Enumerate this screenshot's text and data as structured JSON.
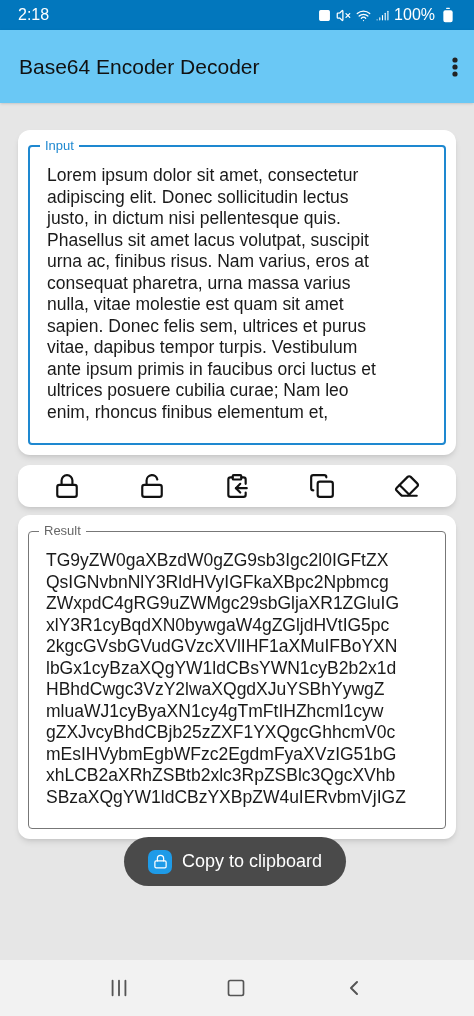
{
  "status_bar": {
    "time": "2:18",
    "battery": "100%"
  },
  "app_bar": {
    "title": "Base64 Encoder Decoder"
  },
  "input": {
    "label": "Input",
    "focused": true,
    "value_lines": [
      "Lorem ipsum dolor sit amet, consectetur",
      "adipiscing elit. Donec sollicitudin lectus",
      "justo, in dictum nisi pellentesque quis.",
      "Phasellus sit amet lacus volutpat, suscipit",
      "urna ac, finibus risus. Nam varius, eros at",
      "consequat pharetra, urna massa varius",
      "nulla, vitae molestie est quam sit amet",
      "sapien. Donec felis sem, ultrices et purus",
      "vitae, dapibus tempor turpis. Vestibulum",
      "ante ipsum primis in faucibus orci luctus et",
      "ultrices posuere cubilia curae; Nam leo",
      "enim, rhoncus finibus elementum et,"
    ]
  },
  "toolbar": [
    {
      "kind": "encode"
    },
    {
      "kind": "decode"
    },
    {
      "kind": "paste"
    },
    {
      "kind": "copy"
    },
    {
      "kind": "clear"
    }
  ],
  "result": {
    "label": "Result",
    "focused": false,
    "value_lines": [
      "TG9yZW0gaXBzdW0gZG9sb3Igc2l0IGFtZX",
      "QsIGNvbnNlY3RldHVyIGFkaXBpc2Npbmcg",
      "ZWxpdC4gRG9uZWMgc29sbGljaXR1ZGluIG",
      "xlY3R1cyBqdXN0bywgaW4gZGljdHVtIG5pc",
      "2kgcGVsbGVudGVzcXVlIHF1aXMuIFBoYXN",
      "lbGx1cyBzaXQgYW1ldCBsYWN1cyB2b2x1d",
      "HBhdCwgc3VzY2lwaXQgdXJuYSBhYywgZ",
      "mluaWJ1cyByaXN1cy4gTmFtIHZhcml1cyw",
      "gZXJvcyBhdCBjb25zZXF1YXQgcGhhcmV0c",
      "mEsIHVybmEgbWFzc2EgdmFyaXVzIG51bG",
      "xhLCB2aXRhZSBtb2xlc3RpZSBlc3QgcXVhb",
      "SBzaXQgYW1ldCBzYXBpZW4uIERvbmVjIGZ"
    ]
  },
  "toast": {
    "text": "Copy to clipboard"
  }
}
